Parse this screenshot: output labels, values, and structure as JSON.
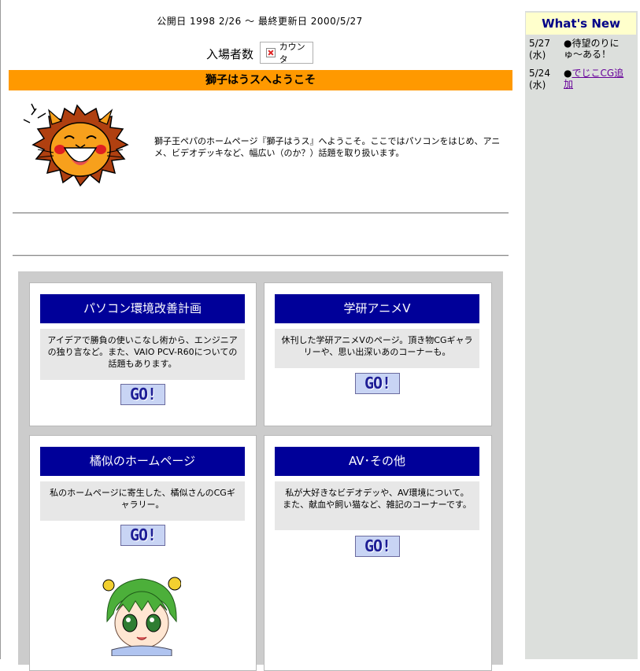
{
  "header": {
    "dates": "公開日 1998 2/26 〜 最終更新日 2000/5/27",
    "visitor_label": "入場者数",
    "counter_alt": "カウンタ"
  },
  "banner": {
    "title": "獅子はうスへようこそ"
  },
  "intro": {
    "text": "獅子王ペパのホームページ『獅子はうス』へようこそ。ここではパソコンをはじめ、アニメ、ビデオデッキなど、幅広い（のか？）話題を取り扱います。"
  },
  "sections": [
    {
      "title": "パソコン環境改善計画",
      "description": "アイデアで勝負の使いこなし術から、エンジニアの独り言など。また、VAIO PCV-R60についての話題もあります。",
      "go_label": "GO!"
    },
    {
      "title": "学研アニメV",
      "description": "休刊した学研アニメVのページ。頂き物CGギャラリーや、思い出深いあのコーナーも。",
      "go_label": "GO!"
    },
    {
      "title": "橘似のホームページ",
      "description": "私のホームページに寄生した、橘似さんのCGギャラリー。",
      "go_label": "GO!"
    },
    {
      "title": "AV･その他",
      "description": "私が大好きなビデオデッや、AV環境について。また、献血や飼い猫など、雑記のコーナーです。",
      "go_label": "GO!"
    }
  ],
  "whats_new": {
    "title": "What's New",
    "items": [
      {
        "date": "5/27",
        "weekday": "(水)",
        "bullet": "●",
        "text": "待望のりにゅ〜ある！",
        "is_link": false
      },
      {
        "date": "5/24",
        "weekday": "(水)",
        "bullet": "●",
        "text": "でじこCG追加",
        "is_link": true
      }
    ]
  },
  "colors": {
    "banner": "#ff9900",
    "section_title_bg": "#000099",
    "sidebar_bg": "#dcdfdc",
    "whats_new_header_bg": "#ffffcc",
    "link": "#660099"
  }
}
